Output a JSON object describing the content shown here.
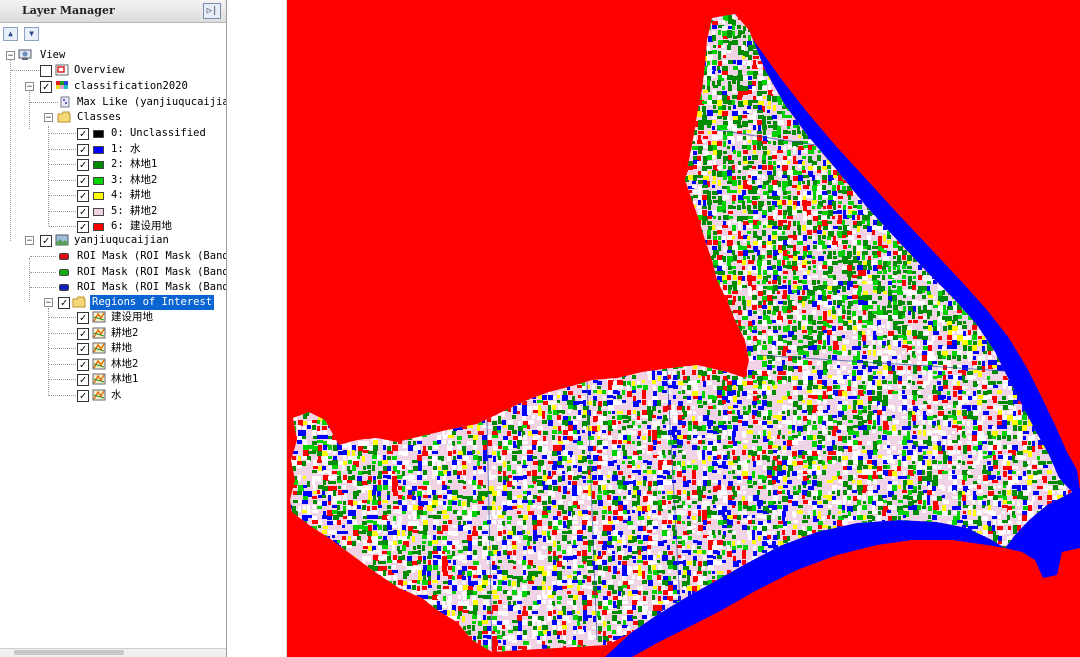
{
  "panel": {
    "title": "Layer Manager",
    "dock_icon": "dock-icon",
    "up_icon": "move-up-icon",
    "down_icon": "move-down-icon"
  },
  "tree": {
    "view": {
      "label": "View"
    },
    "overview": {
      "label": "Overview",
      "checked": false
    },
    "classification": {
      "label": "classification2020",
      "checked": true,
      "method_label": "Max Like (yanjiuqucaijian",
      "classes_label": "Classes",
      "classes": [
        {
          "label": "0: Unclassified",
          "color": "#000000",
          "checked": true
        },
        {
          "label": "1: 水",
          "color": "#0000ff",
          "checked": true
        },
        {
          "label": "2: 林地1",
          "color": "#008c00",
          "checked": true
        },
        {
          "label": "3: 林地2",
          "color": "#00d200",
          "checked": true
        },
        {
          "label": "4: 耕地",
          "color": "#ffff00",
          "checked": true
        },
        {
          "label": "5: 耕地2",
          "color": "#f0d4e6",
          "checked": true
        },
        {
          "label": "6: 建设用地",
          "color": "#ff0000",
          "checked": true
        }
      ]
    },
    "image": {
      "label": "yanjiuqucaijian",
      "checked": true,
      "masks": [
        {
          "label": "ROI Mask (ROI Mask (Band",
          "color": "#e01010"
        },
        {
          "label": "ROI Mask (ROI Mask (Band",
          "color": "#10b010"
        },
        {
          "label": "ROI Mask (ROI Mask (Band",
          "color": "#1020c0"
        }
      ],
      "roi_folder": {
        "label": "Regions of Interest",
        "checked": true
      },
      "rois": [
        {
          "label": "建设用地",
          "checked": true
        },
        {
          "label": "耕地2",
          "checked": true
        },
        {
          "label": "耕地",
          "checked": true
        },
        {
          "label": "林地2",
          "checked": true
        },
        {
          "label": "林地1",
          "checked": true
        },
        {
          "label": "水",
          "checked": true
        }
      ]
    }
  },
  "map": {
    "background_color": "#ff0000",
    "water_color": "#0000ff",
    "colors": {
      "unclassified": "#000000",
      "water": "#0000ff",
      "forest1": "#008c00",
      "forest2": "#00d200",
      "farmland": "#ffff00",
      "farmland2": "#f0d4e6",
      "builtup": "#ff0000",
      "white": "#ffffff"
    }
  }
}
